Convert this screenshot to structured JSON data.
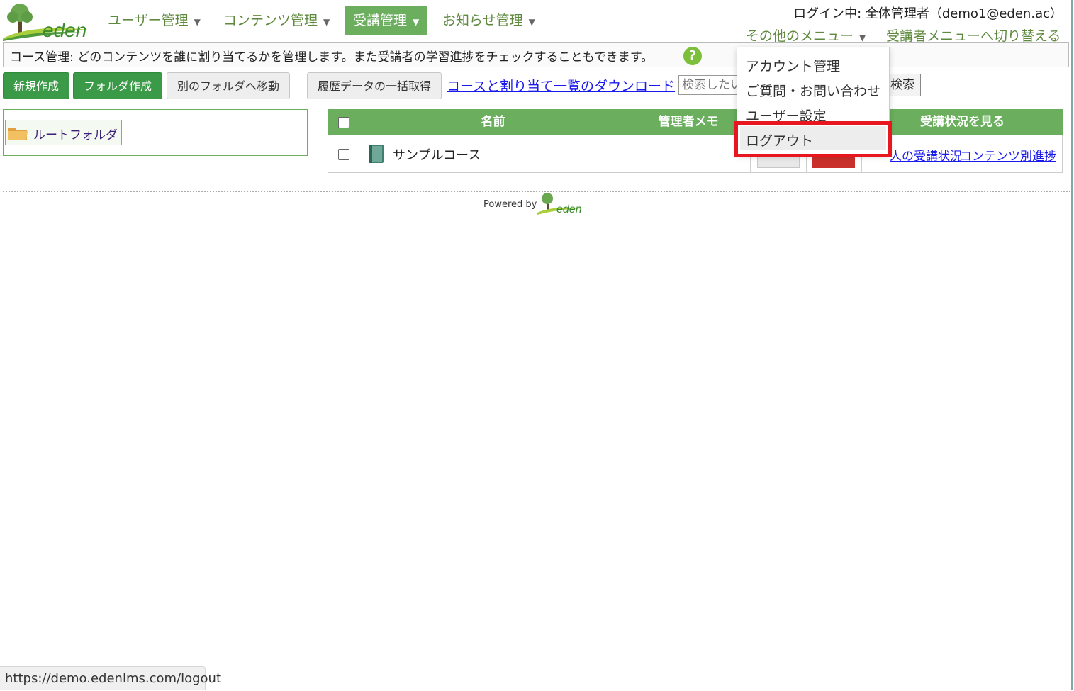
{
  "brand": {
    "logo_text": "eden"
  },
  "nav": [
    {
      "label": "ユーザー管理",
      "active": false
    },
    {
      "label": "コンテンツ管理",
      "active": false
    },
    {
      "label": "受講管理",
      "active": true
    },
    {
      "label": "お知らせ管理",
      "active": false
    }
  ],
  "header": {
    "login_info": "ログイン中: 全体管理者（demo1@eden.ac）",
    "other_menu": "その他のメニュー",
    "switch_menu": "受講者メニューへ切り替える"
  },
  "info_bar": {
    "text": "コース管理: どのコンテンツを誰に割り当てるかを管理します。また受講者の学習進捗をチェックすることもできます。",
    "help": "?"
  },
  "toolbar": {
    "new_label": "新規作成",
    "folder_label": "フォルダ作成",
    "move_label": "別のフォルダへ移動",
    "history_label": "履歴データの一括取得",
    "download_link": "コースと割り当て一覧のダウンロード",
    "search_placeholder": "検索したい",
    "search_button": "検索"
  },
  "folder_tree": {
    "root_label": "ルートフォルダ"
  },
  "table": {
    "headers": {
      "name": "名前",
      "memo": "管理者メモ",
      "status": "受講状況を見る"
    },
    "rows": [
      {
        "name": "サンプルコース",
        "memo": "",
        "status_link_1": "人の受講状況",
        "status_link_2": "コンテンツ別進捗"
      }
    ]
  },
  "dropdown": {
    "items": [
      "アカウント管理",
      "ご質問・お問い合わせ",
      "ユーザー設定",
      "ログアウト"
    ]
  },
  "footer": {
    "powered_by": "Powered by",
    "logo_text": "eden"
  },
  "status_bar": {
    "url": "https://demo.edenlms.com/logout"
  },
  "colors": {
    "brand_green": "#6aae5e",
    "button_green": "#3b9a47",
    "link_blue": "#1a1aee",
    "highlight_red": "#e8171f",
    "danger_red": "#c9302c"
  }
}
